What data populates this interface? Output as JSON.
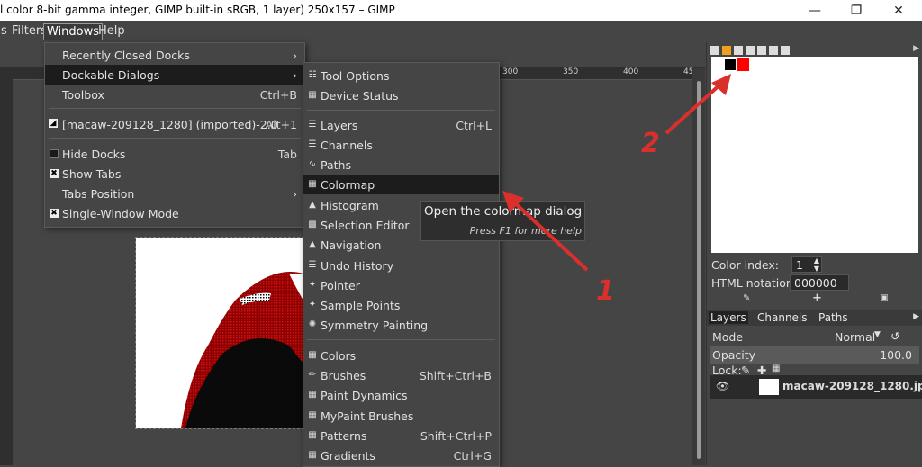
{
  "window": {
    "title": "l color 8-bit gamma integer, GIMP built-in sRGB, 1 layer) 250x157 – GIMP",
    "controls": [
      "—",
      "❐",
      "✕"
    ]
  },
  "menubar": {
    "items": [
      {
        "label": "s"
      },
      {
        "label": "Filters"
      },
      {
        "label": "Windows"
      },
      {
        "label": "Help"
      }
    ]
  },
  "ruler_ticks": [
    "300",
    "350",
    "400",
    "45"
  ],
  "windows_menu": {
    "items": [
      {
        "label": "Recently Closed Docks",
        "accel": "›"
      },
      {
        "label": "Dockable Dialogs",
        "accel": "›"
      },
      {
        "label": "Toolbox",
        "accel": "Ctrl+B"
      },
      {
        "label": "[macaw-209128_1280] (imported)-2.0",
        "accel": "Alt+1"
      },
      {
        "label": "Hide Docks",
        "accel": "Tab"
      },
      {
        "label": "Show Tabs",
        "accel": ""
      },
      {
        "label": "Tabs Position",
        "accel": "›"
      },
      {
        "label": "Single-Window Mode",
        "accel": ""
      }
    ]
  },
  "dockable_menu": {
    "items": [
      {
        "label": "Tool Options",
        "accel": ""
      },
      {
        "label": "Device Status",
        "accel": ""
      },
      {
        "label": "Layers",
        "accel": "Ctrl+L"
      },
      {
        "label": "Channels",
        "accel": ""
      },
      {
        "label": "Paths",
        "accel": ""
      },
      {
        "label": "Colormap",
        "accel": ""
      },
      {
        "label": "Histogram",
        "accel": ""
      },
      {
        "label": "Selection Editor",
        "accel": ""
      },
      {
        "label": "Navigation",
        "accel": ""
      },
      {
        "label": "Undo History",
        "accel": ""
      },
      {
        "label": "Pointer",
        "accel": ""
      },
      {
        "label": "Sample Points",
        "accel": ""
      },
      {
        "label": "Symmetry Painting",
        "accel": ""
      },
      {
        "label": "Colors",
        "accel": ""
      },
      {
        "label": "Brushes",
        "accel": "Shift+Ctrl+B"
      },
      {
        "label": "Paint Dynamics",
        "accel": ""
      },
      {
        "label": "MyPaint Brushes",
        "accel": ""
      },
      {
        "label": "Patterns",
        "accel": "Shift+Ctrl+P"
      },
      {
        "label": "Gradients",
        "accel": "Ctrl+G"
      }
    ]
  },
  "tooltip": {
    "title": "Open the colormap dialog",
    "hint": "Press F1 for more help"
  },
  "colormap": {
    "swatches": [
      "#000000",
      "#ff0000"
    ],
    "index_label": "Color index:",
    "index_value": "1",
    "html_label": "HTML notation:",
    "html_value": "000000"
  },
  "layers_panel": {
    "tabs": [
      "Layers",
      "Channels",
      "Paths"
    ],
    "mode_label": "Mode",
    "mode_value": "Normal",
    "opacity_label": "Opacity",
    "opacity_value": "100.0",
    "lock_label": "Lock:",
    "layer_name": "macaw-209128_1280.jpg"
  },
  "annotations": {
    "arrow1_label": "1",
    "arrow2_label": "2",
    "color": "#d9302c"
  }
}
